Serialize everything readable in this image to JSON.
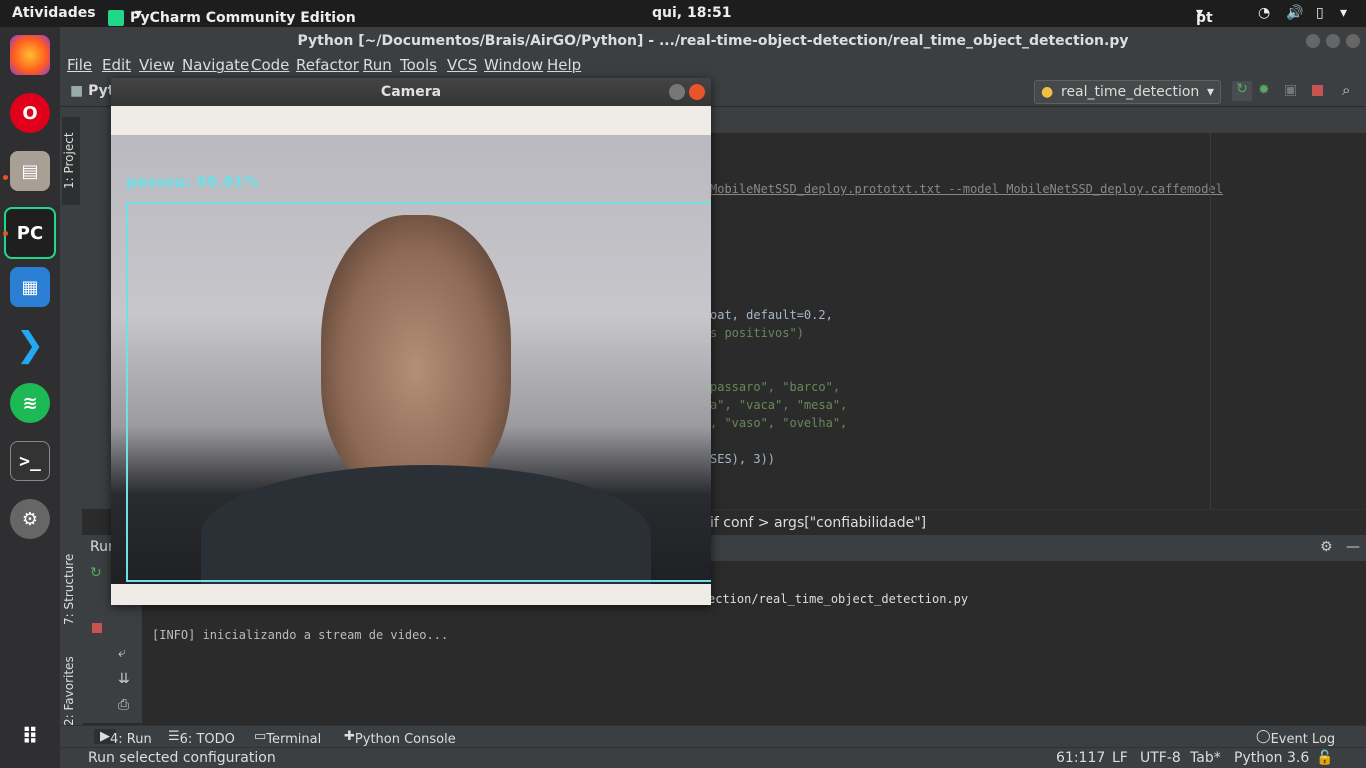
{
  "topbar": {
    "activities": "Atividades",
    "app_name": "PyCharm Community Edition",
    "clock": "qui, 18:51",
    "lang": "pt"
  },
  "ide": {
    "title": "Python [~/Documentos/Brais/AirGO/Python] - .../real-time-object-detection/real_time_object_detection.py",
    "menu": [
      "File",
      "Edit",
      "View",
      "Navigate",
      "Code",
      "Refactor",
      "Run",
      "Tools",
      "VCS",
      "Window",
      "Help"
    ],
    "project_crumb": "Pyt",
    "run_config": "real_time_detection",
    "side_tabs": {
      "project": "1: Project",
      "structure": "7: Structure",
      "favorites": "2: Favorites"
    },
    "code_lines": [
      {
        "text": "MobileNetSSD_deploy.prototxt.txt --model MobileNetSSD_deploy.caffemodel"
      },
      {
        "text": "oat, default=0.2,"
      },
      {
        "text": "s positivos\")"
      },
      {
        "text": "passaro\", \"barco\","
      },
      {
        "text": "a\", \"vaca\", \"mesa\","
      },
      {
        "text": ", \"vaso\", \"ovelha\","
      },
      {
        "text": "SES), 3))"
      }
    ],
    "breadcrumb": "if conf > args[\"confiabilidade\"]",
    "run_label": "Run",
    "run_path": "ection/real_time_object_detection.py",
    "run_output": "[INFO] inicializando a stream de video...",
    "bottom_tabs": {
      "run": "4: Run",
      "todo": "6: TODO",
      "terminal": "Terminal",
      "console": "Python Console",
      "event_log": "Event Log"
    },
    "status": {
      "message": "Run selected configuration",
      "position": "61:117",
      "line_sep": "LF",
      "encoding": "UTF-8",
      "indent": "Tab*",
      "interpreter": "Python 3.6"
    }
  },
  "camera": {
    "title": "Camera",
    "detection_label": "pessoa: 99.91%"
  },
  "colors": {
    "detection": "#6fe0e6",
    "editor_bg": "#2b2b2b",
    "panel_bg": "#3c3f41"
  }
}
